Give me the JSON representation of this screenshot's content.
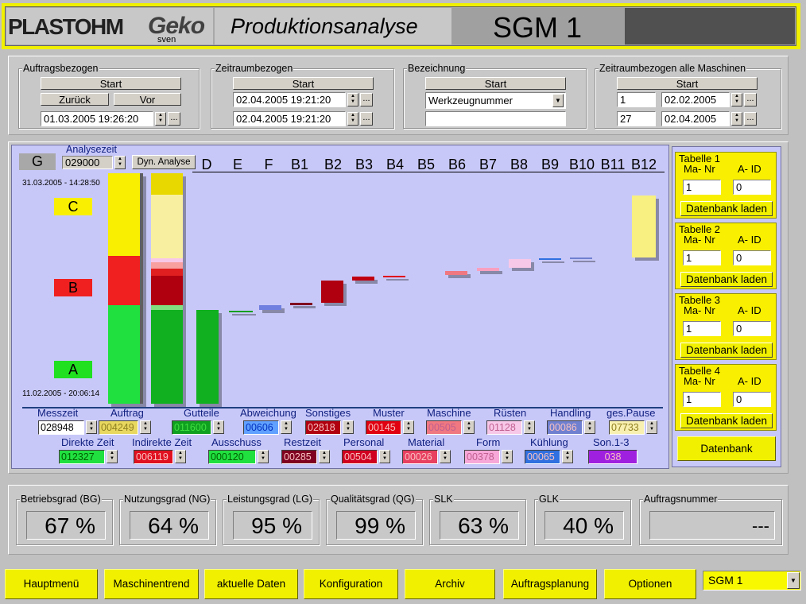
{
  "header": {
    "brand": "PLASTOHM",
    "brand2": "Geko",
    "user": "sven",
    "title": "Produktionsanalyse",
    "machine": "SGM 1"
  },
  "auftrags": {
    "label": "Auftragsbezogen",
    "start": "Start",
    "back": "Zurück",
    "fwd": "Vor",
    "date": "01.03.2005 19:26:20"
  },
  "zeitraum": {
    "label": "Zeitraumbezogen",
    "start": "Start",
    "from": "02.04.2005 19:21:20",
    "to": "02.04.2005 19:21:20"
  },
  "bezeichnung": {
    "label": "Bezeichnung",
    "start": "Start",
    "select": "Werkzeugnummer",
    "value": ""
  },
  "alle": {
    "label": "Zeitraumbezogen alle Maschinen",
    "start": "Start",
    "n1": "1",
    "d1": "02.02.2005",
    "n2": "27",
    "d2": "02.04.2005"
  },
  "chart": {
    "g": "G",
    "analysezeit_label": "Analysezeit",
    "analysezeit": "029000",
    "dyn": "Dyn. Analyse",
    "columns": [
      "D",
      "E",
      "F",
      "B1",
      "B2",
      "B3",
      "B4",
      "B5",
      "B6",
      "B7",
      "B8",
      "B9",
      "B10",
      "B11",
      "B12"
    ],
    "time_top": "31.03.2005 - 14:28:50",
    "time_bottom": "11.02.2005 - 20:06:14",
    "bands": {
      "C": "C",
      "B": "B",
      "A": "A"
    }
  },
  "chart_data": {
    "type": "bar",
    "categories": [
      "G",
      "",
      "D",
      "E",
      "F",
      "B1",
      "B2",
      "B3",
      "B4",
      "B5",
      "B6",
      "B7",
      "B8",
      "B9",
      "B10",
      "B11",
      "B12"
    ]
  },
  "fields": {
    "row1": [
      {
        "label": "Messzeit",
        "value": "028948",
        "color": "#ffffff"
      },
      {
        "label": "Auftrag",
        "value": "004249",
        "color": "#e8d860"
      },
      {
        "label": "Gutteile",
        "value": "011600",
        "color": "#10a020"
      },
      {
        "label": "Abweichung",
        "value": "00606",
        "color": "#60a0ff"
      },
      {
        "label": "Sonstiges",
        "value": "02818",
        "color": "#b00010"
      },
      {
        "label": "Muster",
        "value": "00145",
        "color": "#e00010"
      },
      {
        "label": "Maschine",
        "value": "00505",
        "color": "#f07880"
      },
      {
        "label": "Rüsten",
        "value": "01128",
        "color": "#f8c8e8"
      },
      {
        "label": "Handling",
        "value": "00086",
        "color": "#7080d0"
      },
      {
        "label": "ges.Pause",
        "value": "07733",
        "color": "#f8f0b0"
      }
    ],
    "row2": [
      {
        "label": "Direkte Zeit",
        "value": "012327",
        "color": "#20e040"
      },
      {
        "label": "Indirekte Zeit",
        "value": "006119",
        "color": "#e01020"
      },
      {
        "label": "Ausschuss",
        "value": "000120",
        "color": "#20e040"
      },
      {
        "label": "Restzeit",
        "value": "00285",
        "color": "#800020"
      },
      {
        "label": "Personal",
        "value": "00504",
        "color": "#d00020"
      },
      {
        "label": "Material",
        "value": "00026",
        "color": "#e84060"
      },
      {
        "label": "Form",
        "value": "00378",
        "color": "#f8a8d8"
      },
      {
        "label": "Kühlung",
        "value": "00065",
        "color": "#3070e0"
      },
      {
        "label": "Son.1-3",
        "value": "038",
        "color": "#a020e0"
      }
    ]
  },
  "tables": [
    {
      "label": "Tabelle 1",
      "ma": "Ma- Nr",
      "aid": "A- ID",
      "mav": "1",
      "aidv": "0",
      "btn": "Datenbank laden"
    },
    {
      "label": "Tabelle 2",
      "ma": "Ma- Nr",
      "aid": "A- ID",
      "mav": "1",
      "aidv": "0",
      "btn": "Datenbank laden"
    },
    {
      "label": "Tabelle 3",
      "ma": "Ma- Nr",
      "aid": "A- ID",
      "mav": "1",
      "aidv": "0",
      "btn": "Datenbank laden"
    },
    {
      "label": "Tabelle 4",
      "ma": "Ma- Nr",
      "aid": "A- ID",
      "mav": "1",
      "aidv": "0",
      "btn": "Datenbank laden"
    }
  ],
  "datenbank": "Datenbank",
  "kpis": [
    {
      "label": "Betriebsgrad (BG)",
      "value": "67 %"
    },
    {
      "label": "Nutzungsgrad (NG)",
      "value": "64 %"
    },
    {
      "label": "Leistungsgrad (LG)",
      "value": "95 %"
    },
    {
      "label": "Qualitätsgrad (QG)",
      "value": "99 %"
    },
    {
      "label": "SLK",
      "value": "63 %"
    },
    {
      "label": "GLK",
      "value": "40 %"
    },
    {
      "label": "Auftragsnummer",
      "value": "---"
    }
  ],
  "nav": [
    "Hauptmenü",
    "Maschinentrend",
    "aktuelle Daten",
    "Konfiguration",
    "Archiv",
    "Auftragsplanung",
    "Optionen"
  ],
  "machine_select": "SGM 1"
}
